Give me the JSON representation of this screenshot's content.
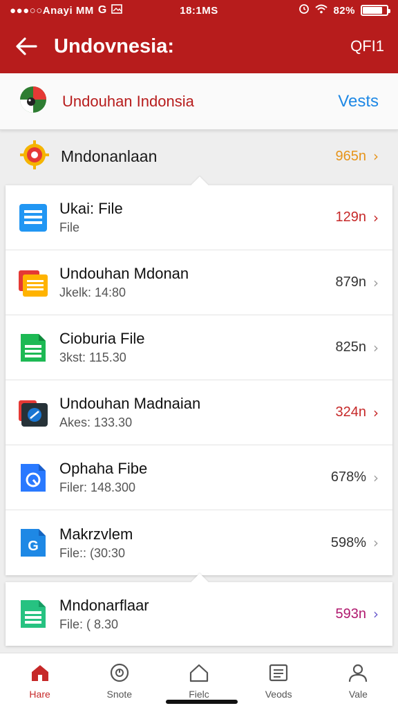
{
  "status_bar": {
    "carrier": "●●●○○Anayi MM",
    "time": "18:1MS",
    "battery": "82%",
    "battery_level": 0.82
  },
  "toolbar": {
    "title": "Undovnesia:",
    "action": "QFI1",
    "back_icon": "arrow-left-icon"
  },
  "source": {
    "title": "Undouhan Indonsia",
    "action": "Vests"
  },
  "summary": {
    "title": "Mndonanlaan",
    "value": "965n",
    "value_color": "#e6941a"
  },
  "files": [
    {
      "title": "Ukai: File",
      "subtitle": "File",
      "value": "129n",
      "icon": "doc-blue-icon",
      "value_color": "#c62828",
      "chevron_color": "#c62828"
    },
    {
      "title": "Undouhan Mdonan",
      "subtitle": "Jkelk: 14:80",
      "value": "879n",
      "icon": "folder-orange-icon",
      "value_color": "#333333",
      "chevron_color": "#9e9e9e"
    },
    {
      "title": "Cioburia File",
      "subtitle": "3kst: 115.30",
      "value": "825n",
      "icon": "sheet-green-icon",
      "value_color": "#333333",
      "chevron_color": "#9e9e9e"
    },
    {
      "title": "Undouhan Madnaian",
      "subtitle": "Akes: 133.30",
      "value": "324n",
      "icon": "folder-dark-icon",
      "value_color": "#c62828",
      "chevron_color": "#c62828"
    },
    {
      "title": "Ophaha Fibe",
      "subtitle": "Filer: 148.300",
      "value": "678%",
      "icon": "doc-gauge-icon",
      "value_color": "#333333",
      "chevron_color": "#9e9e9e"
    },
    {
      "title": "Makrzvlem",
      "subtitle": "File:: (30:30",
      "value": "598%",
      "icon": "doc-g-icon",
      "value_color": "#333333",
      "chevron_color": "#9e9e9e"
    }
  ],
  "extra_file": {
    "title": "Mndonarflaar",
    "subtitle": "File: ( 8.30",
    "value": "593n",
    "icon": "sheet-teal-icon",
    "value_color": "#b0186e",
    "chevron_color": "#6a5acd"
  },
  "nav": [
    {
      "label": "Hare",
      "icon": "home-icon",
      "active": true
    },
    {
      "label": "Snote",
      "icon": "clock-icon",
      "active": false
    },
    {
      "label": "Fielc",
      "icon": "house-outline-icon",
      "active": false
    },
    {
      "label": "Veods",
      "icon": "list-icon",
      "active": false
    },
    {
      "label": "Vale",
      "icon": "person-icon",
      "active": false
    }
  ]
}
